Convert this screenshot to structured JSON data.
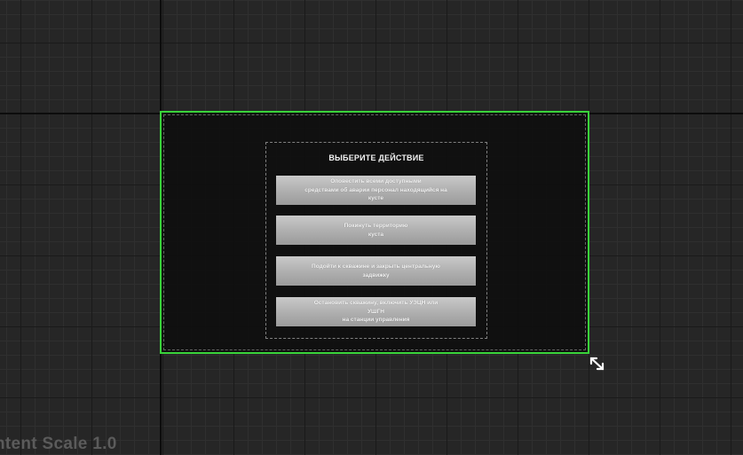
{
  "designer": {
    "scale_label": "ntent Scale 1.0"
  },
  "dialog": {
    "title": "ВЫБЕРИТЕ ДЕЙСТВИЕ",
    "buttons": [
      "Оповестить всеми доступными\nсредствами об аварии персонал находящийся на\nкусте",
      "Покинуть территорию\nкуста",
      "Подойти к скважине и закрыть центральную\nзадвижку",
      "Остановить скважину, включить УЭЦН или\nУШГН\nна станции управления"
    ]
  },
  "colors": {
    "selection_outline": "#39d33a",
    "canvas_background": "#262626",
    "button_fill": "#b4b4b4"
  },
  "icons": {
    "resize_handle": "diagonal-resize-arrows-icon"
  }
}
